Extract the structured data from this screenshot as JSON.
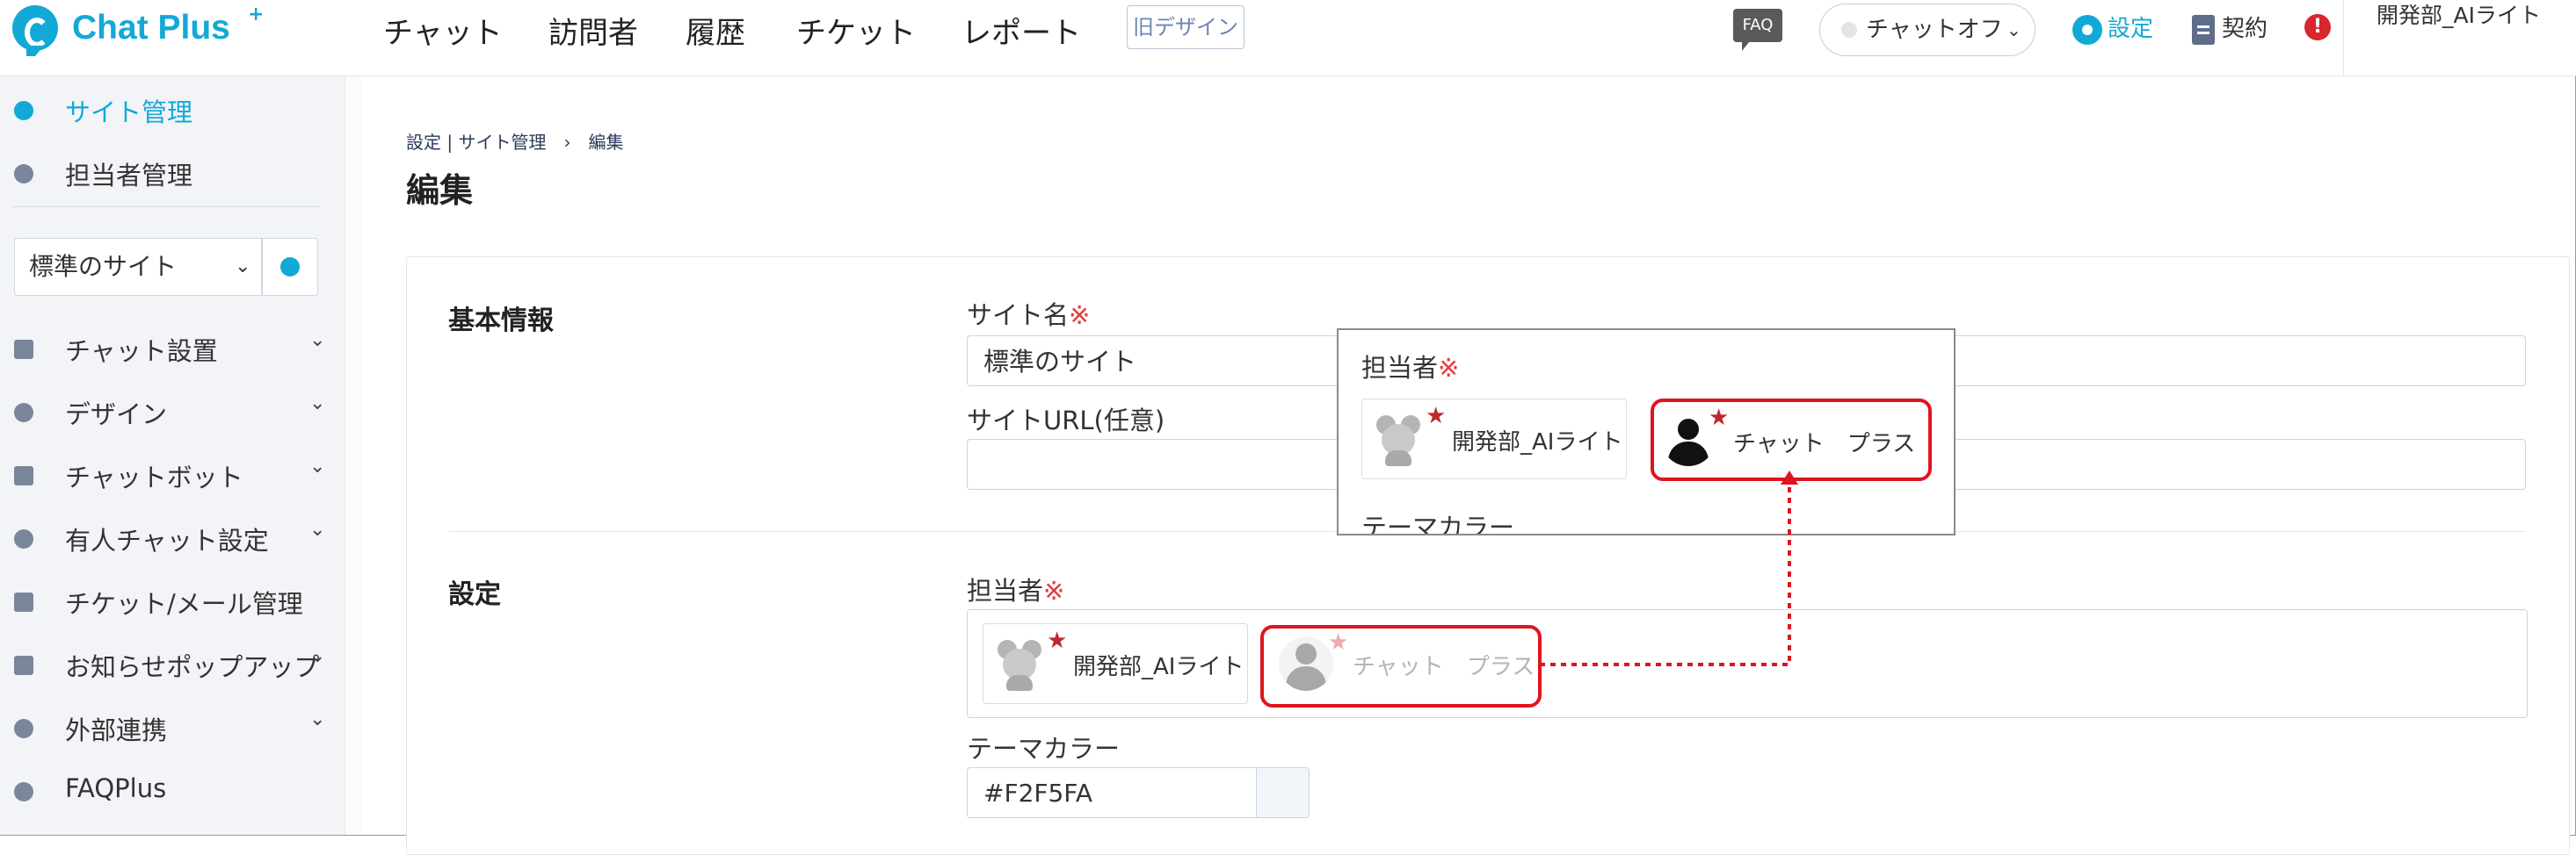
{
  "header": {
    "logo_text": "Chat Plus",
    "logo_plus": "+",
    "nav": [
      "チャット",
      "訪問者",
      "履歴",
      "チケット",
      "レポート"
    ],
    "old_design_label": "旧デザイン",
    "faq_label": "FAQ",
    "chat_status_label": "チャットオフ",
    "chat_status_chevron": "⌄",
    "settings_label": "設定",
    "contract_label": "契約",
    "alert_label": "!",
    "user_name": "開発部_AIライト"
  },
  "sidebar": {
    "top_items": [
      {
        "label": "サイト管理",
        "icon": "gear-icon",
        "active": true
      },
      {
        "label": "担当者管理",
        "icon": "users-icon",
        "active": false
      }
    ],
    "site_select_value": "標準のサイト",
    "chevron": "⌄",
    "menu_items": [
      {
        "label": "チャット設置",
        "icon": "tools-icon",
        "has_chevron": true
      },
      {
        "label": "デザイン",
        "icon": "palette-icon",
        "has_chevron": true
      },
      {
        "label": "チャットボット",
        "icon": "chat-icon",
        "has_chevron": true
      },
      {
        "label": "有人チャット設定",
        "icon": "headset-icon",
        "has_chevron": true
      },
      {
        "label": "チケット/メール管理",
        "icon": "list-icon",
        "has_chevron": false
      },
      {
        "label": "お知らせポップアップ",
        "icon": "popup-icon",
        "has_chevron": true
      },
      {
        "label": "外部連携",
        "icon": "share-icon",
        "has_chevron": true
      },
      {
        "label": "FAQPlus",
        "icon": "faq-shield-icon",
        "has_chevron": false
      }
    ]
  },
  "main": {
    "breadcrumb": "設定 | サイト管理　›　編集",
    "page_title": "編集",
    "basic_info": {
      "section_title": "基本情報",
      "site_name_label": "サイト名",
      "required_mark": "※",
      "site_name_value": "標準のサイト",
      "site_url_label": "サイトURL(任意)",
      "site_url_value": ""
    },
    "settings": {
      "section_title": "設定",
      "assignee_label": "担当者",
      "assignees": [
        {
          "name": "開発部_AIライト",
          "avatar": "mouse-avatar",
          "starred": true
        },
        {
          "name": "チャット　プラス",
          "avatar": "person-avatar",
          "starred": false
        }
      ],
      "theme_color_label": "テーマカラー",
      "theme_color_value": "#F2F5FA"
    }
  },
  "zoom_callout": {
    "assignee_label": "担当者",
    "assignees": [
      {
        "name": "開発部_AIライト",
        "starred": true
      },
      {
        "name": "チャット　プラス",
        "starred": true
      }
    ],
    "theme_color_label": "テーマカラー"
  },
  "colors": {
    "brand": "#13a9d6",
    "highlight": "#e0141e",
    "required": "#e03a3a",
    "star": "#c0262d"
  }
}
